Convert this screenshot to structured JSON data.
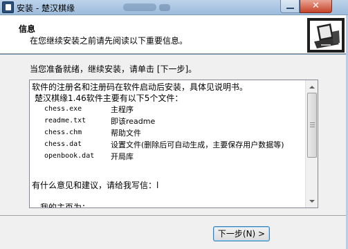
{
  "window": {
    "title": "安装 - 楚汉棋缘",
    "minimize_label": "",
    "close_label": "✕"
  },
  "header": {
    "title": "信息",
    "subtitle": "在您继续安装之前请先阅读以下重要信息。"
  },
  "main": {
    "intro": "当您准备就绪，继续安装，请单击 [下一步]。",
    "memo": {
      "line1": "软件的注册名和注册码在软件启动后安装，具体见说明书。",
      "line2": "楚汉棋缘1.46软件主要有以下5个文件：",
      "files": [
        {
          "name": "chess.exe",
          "desc": "主程序"
        },
        {
          "name": "readme.txt",
          "desc": "即该readme"
        },
        {
          "name": "chess.chm",
          "desc": "帮助文件"
        },
        {
          "name": "chess.dat",
          "desc": "设置文件(删除后可自动生成，主要保存用户数据等)"
        },
        {
          "name": "openbook.dat",
          "desc": "开局库"
        }
      ],
      "line3": "有什么意见和建议，请给我写信：l",
      "line4": "我的主页为："
    }
  },
  "footer": {
    "next_label": "下一步(N) >"
  }
}
